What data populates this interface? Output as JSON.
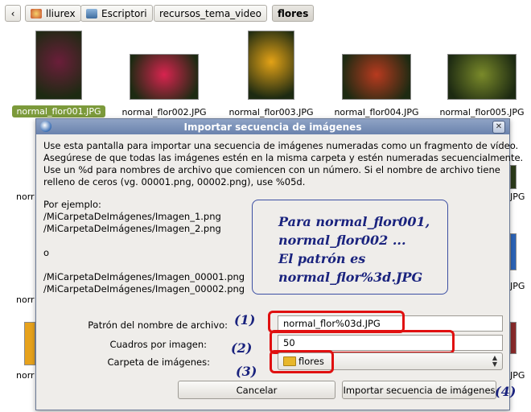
{
  "pathbar": {
    "back_label": "‹",
    "crumbs": [
      {
        "label": "lliurex",
        "icon": "home-icon"
      },
      {
        "label": "Escriptori",
        "icon": "desktop-icon"
      },
      {
        "label": "recursos_tema_video"
      },
      {
        "label": "flores",
        "active": true
      }
    ]
  },
  "files": [
    {
      "name": "normal_flor001.JPG",
      "selected": true,
      "color": "#6b1e3a"
    },
    {
      "name": "normal_flor002.JPG",
      "color": "#d8244f"
    },
    {
      "name": "normal_flor003.JPG",
      "color": "#e3a216"
    },
    {
      "name": "normal_flor004.JPG",
      "color": "#b83a1f"
    },
    {
      "name": "normal_flor005.JPG",
      "color": "#7a8a2a"
    }
  ],
  "background_partial": {
    "left_text": "norr",
    "right_text": "JPG"
  },
  "dialog": {
    "title": "Importar secuencia de imágenes",
    "close_label": "✕",
    "description": [
      "Use esta pantalla para importar una secuencia de imágenes numeradas como un fragmento de vídeo.",
      "Asegúrese de que todas las imágenes estén en la misma carpeta y estén numeradas secuencialmente.",
      "Use un %d para nombres de archivo que comiencen con un número. Si el nombre de archivo tiene",
      "relleno de ceros (vg. 00001.png, 00002.png), use %05d."
    ],
    "example_lines": [
      "Por ejemplo:",
      "/MiCarpetaDeImágenes/Imagen_1.png",
      "/MiCarpetaDeImágenes/Imagen_2.png",
      "",
      "o",
      "",
      "/MiCarpetaDeImágenes/Imagen_00001.png",
      "/MiCarpetaDeImágenes/Imagen_00002.png"
    ],
    "note_lines": [
      "Para normal_flor001,",
      "normal_flor002 ...",
      "El patrón es",
      "normal_flor%3d.JPG"
    ],
    "pattern_label": "Patrón del nombre de archivo:",
    "pattern_value": "normal_flor%03d.JPG",
    "frames_label": "Cuadros por imagen:",
    "frames_value": "50",
    "folder_label": "Carpeta de imágenes:",
    "folder_value": "flores",
    "cancel_label": "Cancelar",
    "import_label": "Importar secuencia de imágenes",
    "annotations": [
      "(1)",
      "(2)",
      "(3)",
      "(4)"
    ],
    "annotation_color": "#e01010"
  }
}
